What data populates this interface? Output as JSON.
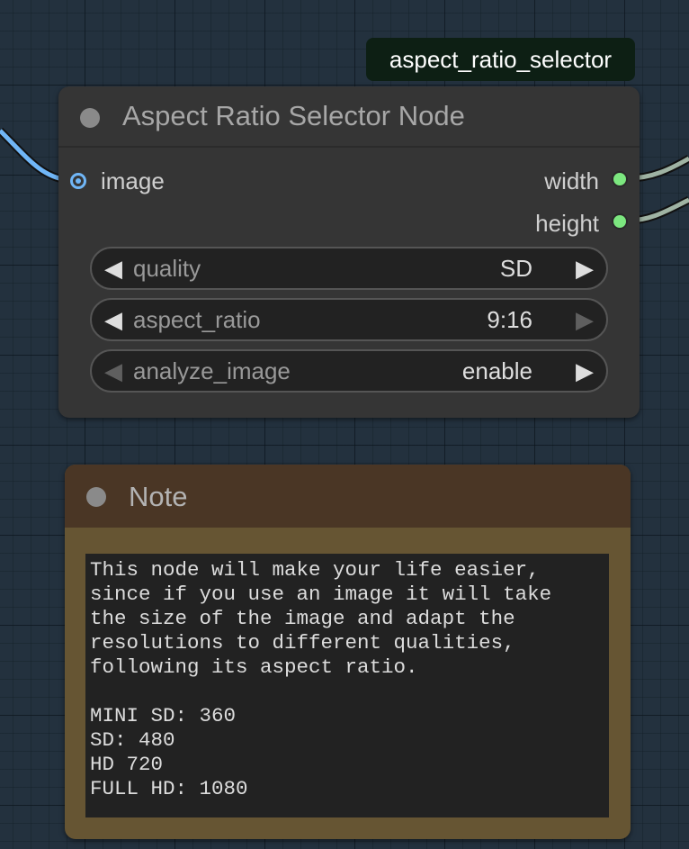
{
  "node_badge": "aspect_ratio_selector",
  "node": {
    "title": "Aspect Ratio Selector Node",
    "inputs": [
      {
        "label": "image",
        "color": "#70b6f7"
      }
    ],
    "outputs": [
      {
        "label": "width",
        "color": "#7ce77f"
      },
      {
        "label": "height",
        "color": "#7ce77f"
      }
    ],
    "widgets": [
      {
        "name": "quality",
        "value": "SD"
      },
      {
        "name": "aspect_ratio",
        "value": "9:16"
      },
      {
        "name": "analyze_image",
        "value": "enable"
      }
    ]
  },
  "note": {
    "title": "Note",
    "text": "This node will make your life easier,\nsince if you use an image it will take\nthe size of the image and adapt the\nresolutions to different qualities,\nfollowing its aspect ratio.\n\nMINI SD: 360\nSD: 480\nHD 720\nFULL HD: 1080"
  },
  "colors": {
    "canvas_bg": "#23313e",
    "node_bg": "#353535",
    "note_header": "#4a3625",
    "note_body": "#665533",
    "link_image": "#70b6f7",
    "link_output": "#9fb3a3"
  }
}
